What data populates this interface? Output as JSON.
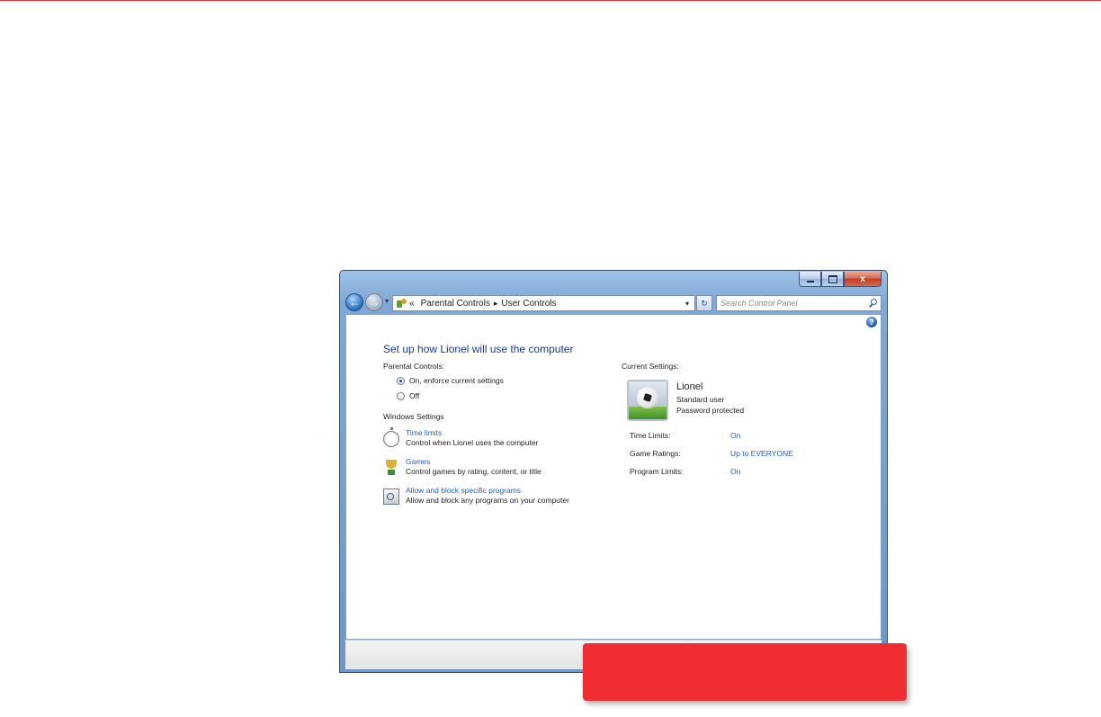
{
  "colors": {
    "accent_red": "#ef2d32",
    "link_blue": "#1f5fbf",
    "heading_blue": "#1e3a8a",
    "window_frame": "#7fa8d4"
  },
  "window": {
    "controls": {
      "minimize_icon": "minimize-icon",
      "maximize_icon": "maximize-icon",
      "close_label": "x"
    }
  },
  "nav": {
    "back_icon": "back-arrow-icon",
    "forward_icon": "forward-arrow-icon",
    "dropdown_glyph": "▾",
    "overflow": "«",
    "breadcrumbs": [
      "Parental Controls",
      "User Controls"
    ],
    "separator": "▸",
    "address_dropdown": "▾",
    "refresh_glyph": "↻",
    "search_placeholder": "Search Control Panel"
  },
  "content": {
    "help_glyph": "?",
    "heading": "Set up how Lionel will use the computer",
    "parental_controls_label": "Parental Controls:",
    "radio_options": [
      {
        "label": "On, enforce current settings",
        "selected": true
      },
      {
        "label": "Off",
        "selected": false
      }
    ],
    "windows_settings_label": "Windows Settings",
    "settings": [
      {
        "link": "Time limits",
        "description": "Control when Lionel uses the computer",
        "icon": "stopwatch-icon"
      },
      {
        "link": "Games",
        "description": "Control games by rating, content, or title",
        "icon": "trophy-icon"
      },
      {
        "link": "Allow and block specific programs",
        "description": "Allow and block any programs on your computer",
        "icon": "programs-icon"
      }
    ],
    "current_settings_label": "Current Settings:",
    "user": {
      "name": "Lionel",
      "account_type": "Standard user",
      "password_status": "Password protected",
      "avatar_icon": "soccer-ball-avatar"
    },
    "limits": [
      {
        "label": "Time Limits:",
        "value": "On"
      },
      {
        "label": "Game Ratings:",
        "value": "Up to EVERYONE"
      },
      {
        "label": "Program Limits:",
        "value": "On"
      }
    ]
  }
}
